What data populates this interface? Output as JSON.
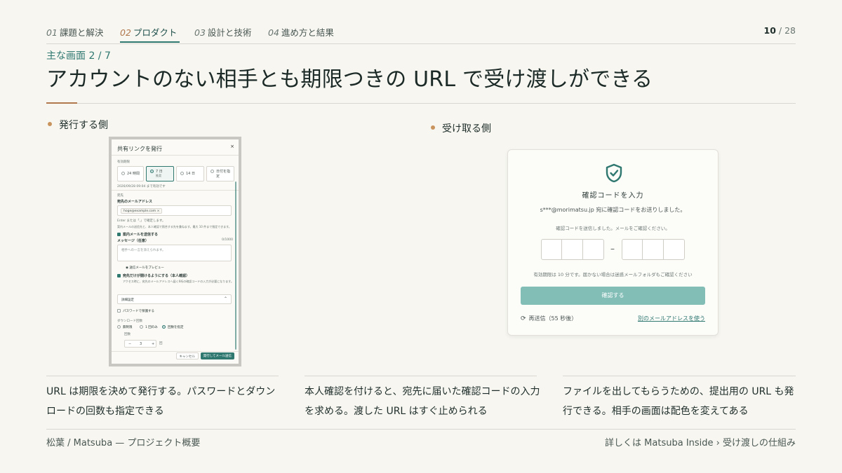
{
  "nav": {
    "tabs": [
      {
        "num": "01",
        "label": "課題と解決"
      },
      {
        "num": "02",
        "label": "プロダクト"
      },
      {
        "num": "03",
        "label": "設計と技術"
      },
      {
        "num": "04",
        "label": "進め方と結果"
      }
    ],
    "active_tab": "02",
    "page_current": "10",
    "page_total": "/ 28"
  },
  "heading": {
    "eyebrow": "主な画面 2 / 7",
    "title": "アカウントのない相手とも期限つきの URL で受け渡しができる"
  },
  "sections": {
    "issuer_label": "発行する側",
    "recipient_label": "受け取る側"
  },
  "issuer_mock": {
    "title": "共有リンクを発行",
    "close": "×",
    "expiry_label": "有効期限",
    "options": [
      {
        "label": "24 時間",
        "sub": ""
      },
      {
        "label": "7 日",
        "sub": "推奨"
      },
      {
        "label": "14 日",
        "sub": ""
      },
      {
        "label": "日付を指",
        "sub": "定"
      }
    ],
    "expiry_note": "2026/09/28 09:04 まで有効です",
    "recipient_label": "宛先",
    "email_label": "宛先のメールアドレス",
    "email_chip": "hoge@example.com",
    "email_hint1": "Enter または「,」で確定します。",
    "email_hint2": "案内メールの送信先と、本人確認で照合する先を兼ねます。最大 10 件まで指定できます。",
    "send_mail": "案内メールを送信する",
    "message_label": "メッセージ（任意）",
    "message_count": "0/1000",
    "message_placeholder": "相手への一言を添えられます。",
    "preview": "送信メールをプレビュー",
    "verify": "宛先だけが開けるようにする（本人確認）",
    "verify_hint": "アクセス時に、宛先のメールアドレスへ届く6桁の確認コードの入力が必要になります。",
    "advanced": "詳細設定",
    "password": "パスワードで保護する",
    "download_label": "ダウンロード回数",
    "download_options": [
      "無制限",
      "1 回のみ",
      "回数を指定"
    ],
    "count_label": "回数",
    "count_minus": "−",
    "count_value": "3",
    "count_plus": "+",
    "count_unit": "回",
    "cancel": "キャンセル",
    "submit": "発行してメール送信"
  },
  "recipient_mock": {
    "title": "確認コードを入力",
    "subtitle": "s***@morimatsu.jp 宛に確認コードをお送りしました。",
    "note": "確認コードを送信しました。メールをご確認ください。",
    "dash": "–",
    "expiry": "有効期限は 10 分です。届かない場合は迷惑メールフォルダもご確認ください",
    "confirm": "確認する",
    "resend": "再送信（55 秒後）",
    "alt_email": "別のメールアドレスを使う"
  },
  "captions": [
    "URL は期限を決めて発行する。パスワードとダウンロードの回数も指定できる",
    "本人確認を付けると、宛先に届いた確認コードの入力を求める。渡した URL はすぐ止められる",
    "ファイルを出してもらうための、提出用の URL も発行できる。相手の画面は配色を変えてある"
  ],
  "footer": {
    "left": "松葉 / Matsuba — プロジェクト概要",
    "right": "詳しくは Matsuba Inside › 受け渡しの仕組み"
  },
  "colors": {
    "accent_teal": "#2f7870",
    "accent_copper": "#b1784d",
    "button_teal_light": "#82bdb6",
    "background": "#f7f6f1"
  }
}
